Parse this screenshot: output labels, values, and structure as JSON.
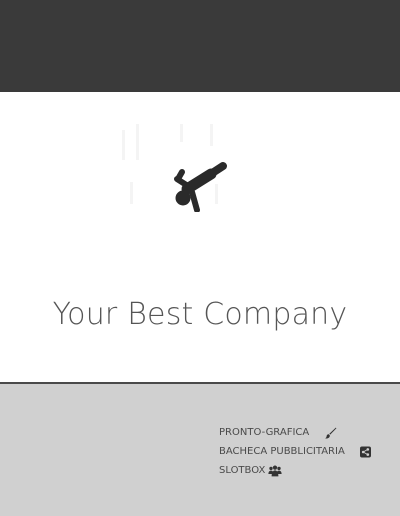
{
  "header": {
    "background": "#3a3a3a"
  },
  "hero": {
    "logo_icon": "acrobat-figure-icon",
    "company_name": "Your Best Company"
  },
  "footer": {
    "background": "#d0d0d0",
    "links": [
      {
        "label": "PRONTO-GRAFICA",
        "icon": "brush-icon"
      },
      {
        "label": "BACHECA PUBBLICITARIA",
        "icon": "share-icon"
      },
      {
        "label": "SLOTBOX",
        "icon": "users-icon"
      }
    ]
  }
}
